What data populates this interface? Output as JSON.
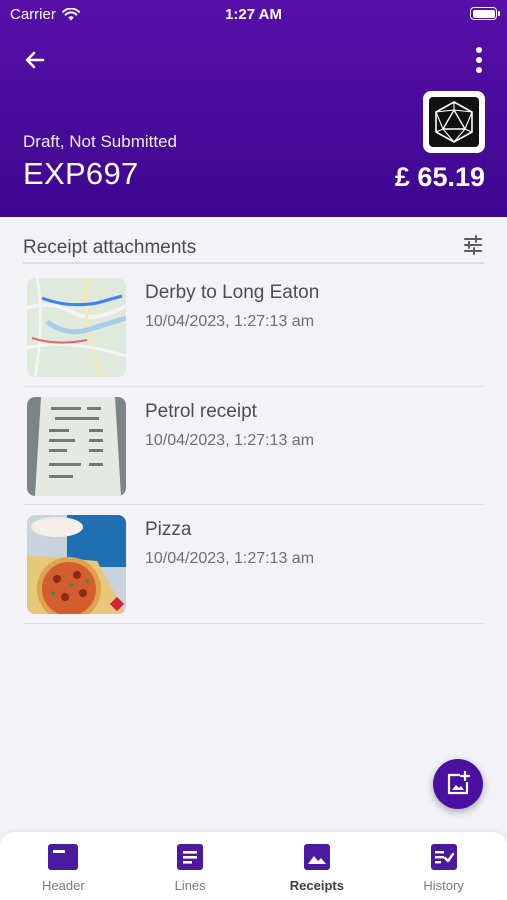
{
  "status_bar": {
    "carrier": "Carrier",
    "time": "1:27 AM"
  },
  "header": {
    "status": "Draft, Not Submitted",
    "expense_id": "EXP697",
    "amount": "£ 65.19",
    "logo_icon": "d20-dice-icon"
  },
  "section": {
    "title": "Receipt attachments",
    "filter_icon": "tune-icon"
  },
  "receipts": [
    {
      "title": "Derby to Long Eaton",
      "date": "10/04/2023, 1:27:13 am",
      "thumb": "map-thumbnail"
    },
    {
      "title": "Petrol receipt",
      "date": "10/04/2023, 1:27:13 am",
      "thumb": "receipt-thumbnail"
    },
    {
      "title": "Pizza",
      "date": "10/04/2023, 1:27:13 am",
      "thumb": "pizza-thumbnail"
    }
  ],
  "tabs": [
    {
      "label": "Header",
      "icon": "header-icon",
      "active": false
    },
    {
      "label": "Lines",
      "icon": "lines-icon",
      "active": false
    },
    {
      "label": "Receipts",
      "icon": "image-icon",
      "active": true
    },
    {
      "label": "History",
      "icon": "checklist-icon",
      "active": false
    }
  ],
  "colors": {
    "brand": "#4a10a0",
    "header_top": "#5810a8",
    "header_bottom": "#3d078f",
    "icon_purple": "#4b1a9e"
  }
}
